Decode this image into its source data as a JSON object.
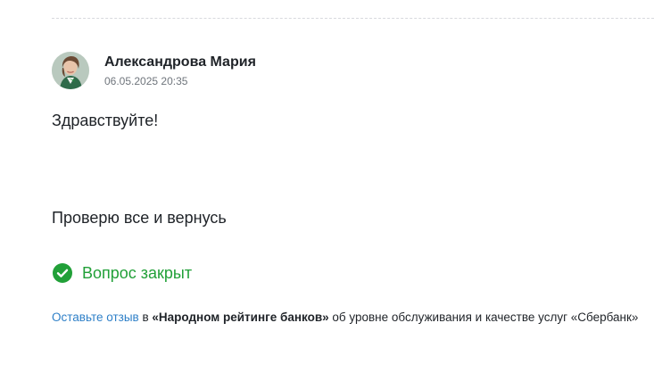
{
  "review": {
    "author": {
      "name": "Александрова Мария",
      "date": "06.05.2025 20:35"
    },
    "messages": [
      "Здравствуйте!",
      "Проверю все и вернусь"
    ],
    "status": {
      "label": "Вопрос закрыт",
      "icon": "check-circle-icon",
      "color": "#21a038"
    }
  },
  "footer": {
    "link_text": "Оставьте отзыв",
    "text_in": " в ",
    "rating_name": "«Народном рейтинге банков»",
    "text_rest": " об уровне обслуживания и качестве услуг «Сбербанк»",
    "link_color": "#2f80c8"
  }
}
